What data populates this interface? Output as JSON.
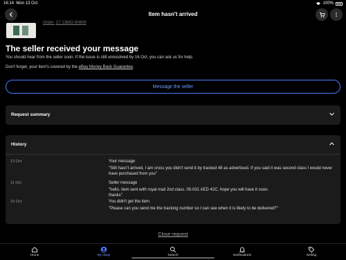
{
  "status_bar": {
    "time": "16:14",
    "date": "Mon 13 Oct",
    "battery": "100%"
  },
  "header": {
    "title": "Item hasn't arrived"
  },
  "order": {
    "label": "Order:",
    "number": "17-13682-60608"
  },
  "headline": "The seller received your message",
  "info_line1": "You should hear from the seller soon. If the issue is still unresolved by 16 Oct, you can ask us for help.",
  "info_line2_prefix": "Don't forget, your item's covered by the ",
  "info_line2_link": "eBay Money Back Guarantee",
  "info_line2_suffix": ".",
  "message_button": "Message the seller",
  "request_summary": {
    "title": "Request summary"
  },
  "history": {
    "title": "History",
    "entries": [
      {
        "date": "13 Oct",
        "title": "Your message",
        "body": "\"Still hasn't arrived, I am cross you didn't send it by tracked 48 as advertised. If you said it was second class I would never have purchased from you\""
      },
      {
        "date": "11 Oct",
        "title": "Seller message",
        "body": "\"hello. item sent with royal mail  2nd class. 05-031 AED 42C. hope you will have it soon.\nthanks\""
      },
      {
        "date": "10 Oct",
        "title": "You didn't get the item",
        "body": "\"Please can you send me the tracking number so I can see when it is likely to be delivered?\""
      }
    ]
  },
  "close_request": "Close request",
  "tabs": [
    {
      "label": "Home",
      "icon": "home-icon"
    },
    {
      "label": "My eBay",
      "icon": "profile-icon",
      "active": true
    },
    {
      "label": "Search",
      "icon": "search-icon"
    },
    {
      "label": "Notifications",
      "icon": "bell-icon"
    },
    {
      "label": "Selling",
      "icon": "tag-icon"
    }
  ],
  "colors": {
    "accent": "#4a7cff",
    "background": "#000000",
    "panel": "#1b1b1b"
  }
}
